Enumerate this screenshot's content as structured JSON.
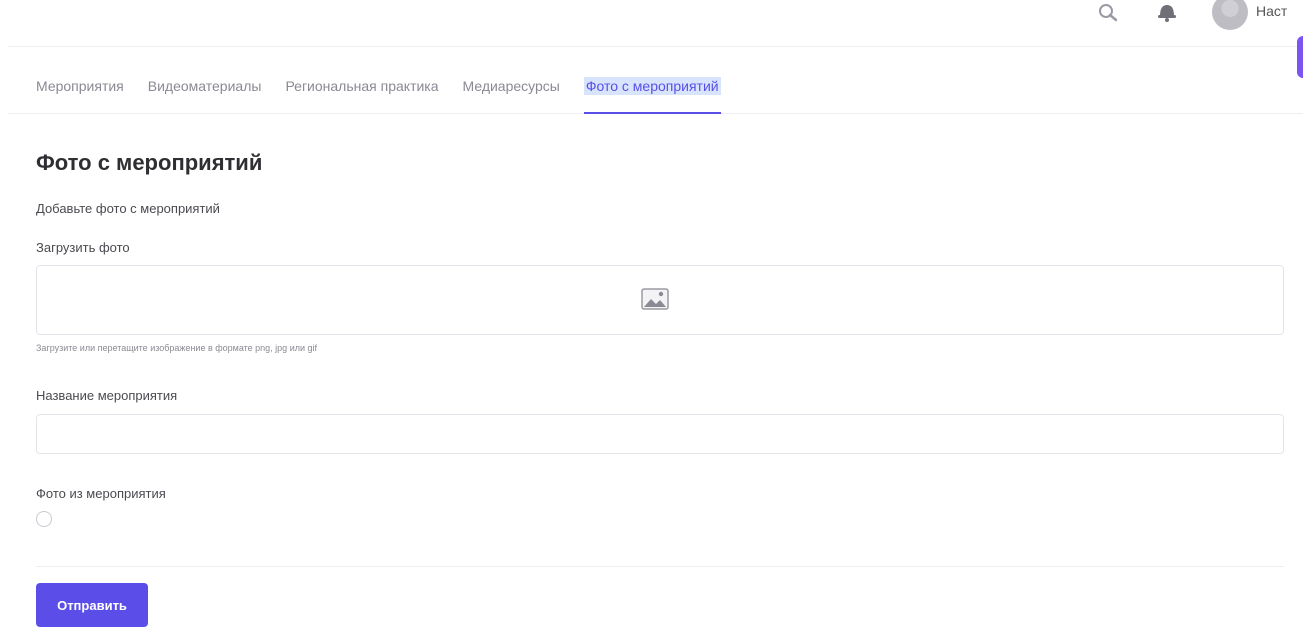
{
  "header": {
    "user_name": "Наст",
    "icons": [
      "search-icon",
      "bell-icon",
      "avatar"
    ]
  },
  "tabs": [
    {
      "label": "Мероприятия",
      "active": false
    },
    {
      "label": "Видеоматериалы",
      "active": false
    },
    {
      "label": "Региональная практика",
      "active": false
    },
    {
      "label": "Медиаресурсы",
      "active": false
    },
    {
      "label": "Фото с мероприятий",
      "active": true
    }
  ],
  "form": {
    "title": "Фото с мероприятий",
    "subtitle": "Добавьте фото с мероприятий",
    "upload_label": "Загрузить фото",
    "upload_icon": "image-icon",
    "upload_hint": "Загрузите или перетащите изображение в формате png, jpg или gif",
    "event_name_label": "Название мероприятия",
    "event_name_value": "",
    "from_event_label": "Фото из мероприятия",
    "from_event_checked": false,
    "submit_label": "Отправить"
  },
  "colors": {
    "accent": "#5b4ee8",
    "tab_inactive": "#8a8a94",
    "border": "#e4e4ea",
    "selection_highlight": "#d8e4fb"
  }
}
